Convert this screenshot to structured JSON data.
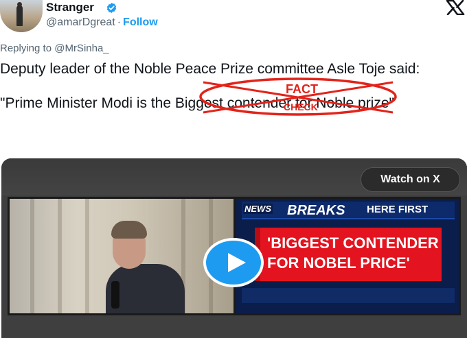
{
  "author": {
    "name": "Stranger",
    "handle": "@amarDgreat",
    "separator": "·",
    "follow_label": "Follow"
  },
  "reply": {
    "prefix": "Replying to",
    "mention": "@MrSinha_"
  },
  "tweet": {
    "line1": "Deputy leader of the Noble Peace Prize committee Asle Toje said:",
    "quote": "\"Prime Minister Modi is the Biggest contender for Noble prize\""
  },
  "stamp": {
    "top": "FACT",
    "bottom": "CHECK",
    "color": "#e2231a"
  },
  "media": {
    "watch_label": "Watch on X",
    "news_tag": "NEWS",
    "breaks_tag": "BREAKS",
    "here_first": "HERE FIRST",
    "headline": "'BIGGEST CONTENDER FOR NOBEL PRICE'"
  },
  "colors": {
    "accent": "#1d9bf0",
    "text": "#0f1419",
    "secondary": "#536471",
    "breaking_red": "#e3141f",
    "channel_blue": "#0b1d4a"
  },
  "icons": [
    "verified-badge-icon",
    "x-logo-icon",
    "india-flag-icon",
    "play-icon"
  ]
}
